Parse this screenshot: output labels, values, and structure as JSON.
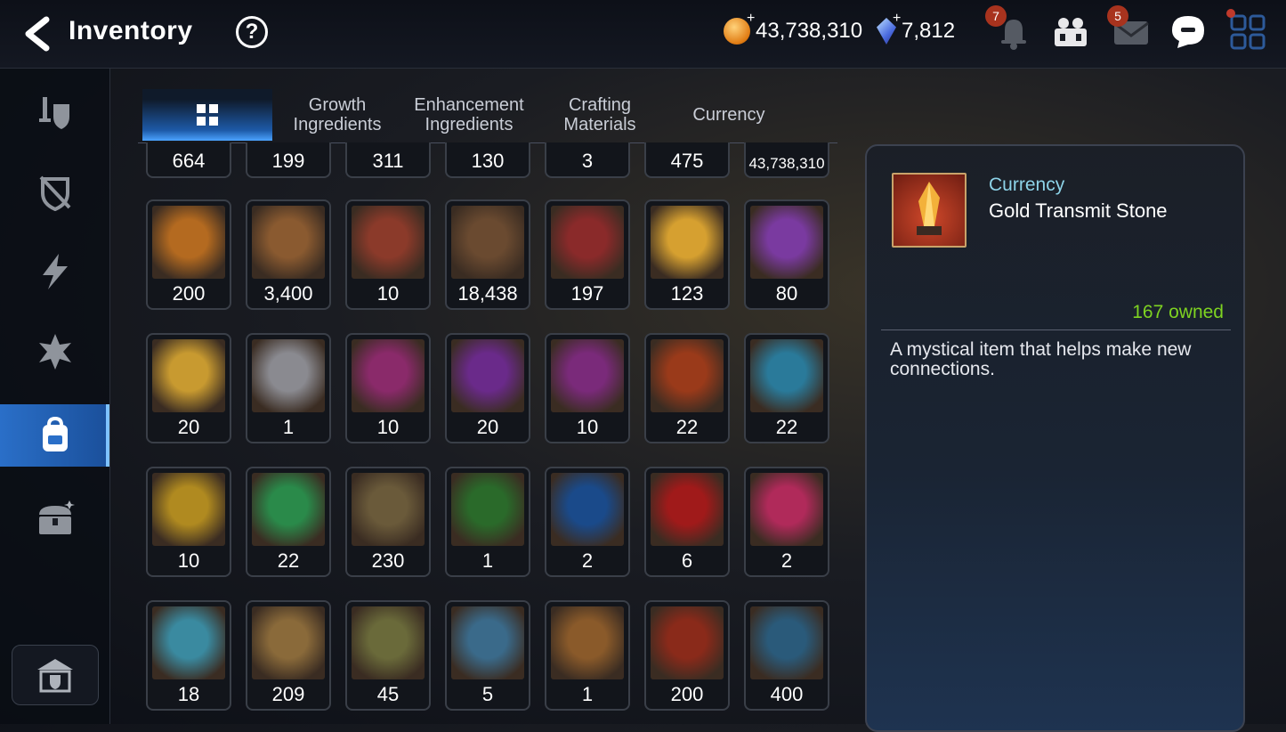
{
  "header": {
    "title": "Inventory",
    "gold": "43,738,310",
    "crystal": "7,812",
    "notif_badge": "7",
    "mail_badge": "5"
  },
  "tabs": [
    {
      "label": "",
      "icon": "grid-icon",
      "active": true
    },
    {
      "label": "Growth Ingredients"
    },
    {
      "label": "Enhancement Ingredients"
    },
    {
      "label": "Crafting Materials"
    },
    {
      "label": "Currency"
    }
  ],
  "sidebar": {
    "items": [
      {
        "icon": "equipment-icon"
      },
      {
        "icon": "artifact-icon"
      },
      {
        "icon": "lightning-icon"
      },
      {
        "icon": "exclusive-icon"
      },
      {
        "icon": "backpack-icon",
        "active": true
      },
      {
        "icon": "chest-icon"
      }
    ],
    "bottom_icon": "storage-icon"
  },
  "grid": {
    "partial_row": [
      "664",
      "199",
      "311",
      "130",
      "3",
      "475",
      "43,738,310"
    ],
    "rows": [
      [
        "200",
        "3,400",
        "10",
        "18,438",
        "197",
        "123",
        "80"
      ],
      [
        "20",
        "1",
        "10",
        "20",
        "10",
        "22",
        "22"
      ],
      [
        "10",
        "22",
        "230",
        "1",
        "2",
        "6",
        "2"
      ],
      [
        "18",
        "209",
        "45",
        "5",
        "1",
        "200",
        "400"
      ]
    ],
    "colors": [
      [
        "#b46a20",
        "#8a5a30",
        "#8b3a2a",
        "#6a4a30",
        "#8a2a2a",
        "#d6a030",
        "#7a3aa0"
      ],
      [
        "#c89a30",
        "#8a8a90",
        "#8a2a6a",
        "#6a2a8a",
        "#7a2a7a",
        "#9a3a1a",
        "#2a7a9a"
      ],
      [
        "#b08a20",
        "#2a8a4a",
        "#6a5a3a",
        "#2a6a2a",
        "#1a4a8a",
        "#a01a1a",
        "#b02a5a"
      ],
      [
        "#3a8aa0",
        "#8a6a3a",
        "#6a6a3a",
        "#3a6a8a",
        "#8a5a2a",
        "#8a2a1a",
        "#2a5a7a"
      ]
    ]
  },
  "detail": {
    "category": "Currency",
    "name": "Gold Transmit Stone",
    "owned": "167 owned",
    "description": "A mystical item that helps make new connections."
  },
  "colors": {
    "accent": "#2a6fc8",
    "owned": "#7ed321",
    "category": "#8dd3e8"
  }
}
